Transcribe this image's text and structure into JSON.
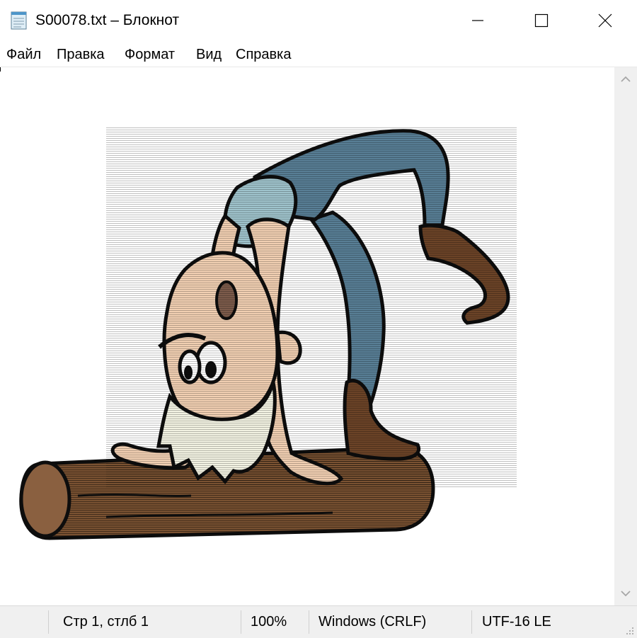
{
  "window": {
    "title": "S00078.txt – Блокнот",
    "icon": "notepad-icon",
    "controls": [
      "minimize-icon",
      "maximize-icon",
      "close-icon"
    ]
  },
  "menu": [
    {
      "label": "Файл"
    },
    {
      "label": "Правка"
    },
    {
      "label": "Формат"
    },
    {
      "label": "Вид"
    },
    {
      "label": "Справка"
    }
  ],
  "editor": {
    "content_kind": "ascii-art cartoon: old bearded man doing a back-bend over a log",
    "colors": {
      "log": "#7a5232",
      "skin": "#f1cfb2",
      "pants": "#587e95",
      "shirt": "#9fc3cc",
      "beard": "#f2f2e2",
      "boot": "#6b4327",
      "outline": "#0d0d0d"
    }
  },
  "status": {
    "position": "Стр 1, стлб 1",
    "zoom": "100%",
    "line_ending": "Windows (CRLF)",
    "encoding": "UTF-16 LE"
  }
}
